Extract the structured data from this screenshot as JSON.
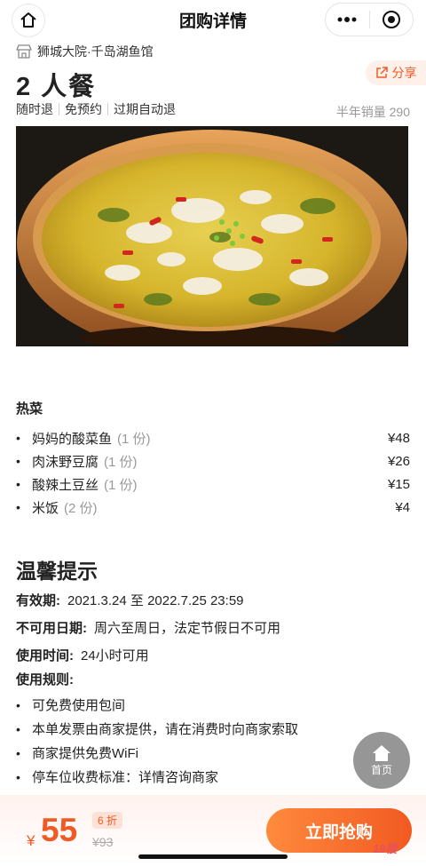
{
  "header": {
    "title": "团购详情"
  },
  "shop": {
    "name": "狮城大院·千岛湖鱼馆"
  },
  "deal": {
    "title": "2 人餐",
    "share_label": "分享",
    "tags": [
      "随时退",
      "免预约",
      "过期自动退"
    ],
    "sales": "半年销量 290"
  },
  "menu": {
    "section": "热菜",
    "items": [
      {
        "name": "妈妈的酸菜鱼",
        "qty": "(1 份)",
        "price": "¥48"
      },
      {
        "name": "肉沫野豆腐",
        "qty": "(1 份)",
        "price": "¥26"
      },
      {
        "name": "酸辣土豆丝",
        "qty": "(1 份)",
        "price": "¥15"
      },
      {
        "name": "米饭",
        "qty": "(2 份)",
        "price": "¥4"
      }
    ]
  },
  "tips": {
    "title": "温馨提示",
    "validity_label": "有效期:",
    "validity_value": "2021.3.24 至 2022.7.25 23:59",
    "unavailable_label": "不可用日期:",
    "unavailable_value": "周六至周日，法定节假日不可用",
    "time_label": "使用时间:",
    "time_value": "24小时可用",
    "rules_label": "使用规则:",
    "rules": [
      "可免费使用包间",
      "本单发票由商家提供，请在消费时向商家索取",
      "商家提供免费WiFi",
      "停车位收费标准：详情咨询商家"
    ]
  },
  "float_home": {
    "label": "首页"
  },
  "bottom": {
    "currency": "¥",
    "price": "55",
    "discount": "6 折",
    "original_price": "¥93",
    "buy_label": "立即抢购",
    "watermark": "19楼"
  },
  "colors": {
    "accent": "#f05a24",
    "accent_light": "#ff8a3d"
  }
}
